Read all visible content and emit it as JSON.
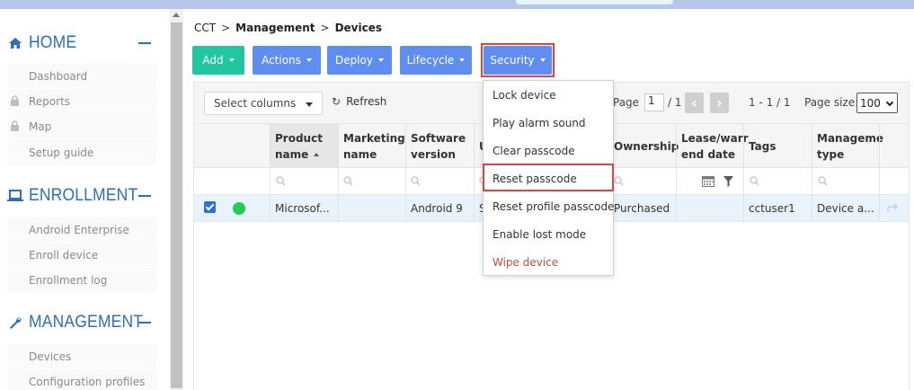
{
  "sidebar": {
    "sections": [
      {
        "label": "HOME",
        "icon": "home-icon",
        "items": [
          {
            "label": "Dashboard",
            "locked": false
          },
          {
            "label": "Reports",
            "locked": true
          },
          {
            "label": "Map",
            "locked": true
          },
          {
            "label": "Setup guide",
            "locked": false
          }
        ]
      },
      {
        "label": "ENROLLMENT",
        "icon": "laptop-icon",
        "items": [
          {
            "label": "Android Enterprise"
          },
          {
            "label": "Enroll device"
          },
          {
            "label": "Enrollment log"
          }
        ]
      },
      {
        "label": "MANAGEMENT",
        "icon": "wrench-icon",
        "items": [
          {
            "label": "Devices"
          },
          {
            "label": "Configuration profiles"
          }
        ]
      }
    ]
  },
  "breadcrumb": {
    "root": "CCT",
    "sep": ">",
    "level1": "Management",
    "level2": "Devices"
  },
  "toolbar": {
    "add": "Add",
    "actions": "Actions",
    "deploy": "Deploy",
    "lifecycle": "Lifecycle",
    "security": "Security"
  },
  "grid": {
    "select_columns": "Select columns",
    "refresh": "Refresh",
    "pager": {
      "page_label": "Page",
      "page_value": "1",
      "page_total": "/ 1",
      "range": "1 - 1 / 1",
      "size_label": "Page size:",
      "size_value": "100"
    },
    "columns": [
      {
        "line1": "Product",
        "line2": "name"
      },
      {
        "line1": "Marketing",
        "line2": "name"
      },
      {
        "line1": "Software",
        "line2": "version"
      },
      {
        "line1": "U",
        "line2": ""
      },
      {
        "line1": "Ownership",
        "line2": ""
      },
      {
        "line1": "Lease/warr",
        "line2": "end date"
      },
      {
        "line1": "Tags",
        "line2": ""
      },
      {
        "line1": "Manageme",
        "line2": "type"
      }
    ],
    "row": {
      "product_name": "Microsof...",
      "marketing_name": "",
      "software_version": "Android 9",
      "u": "S",
      "ownership": "Purchased",
      "lease_end": "",
      "tags": "cctuser1",
      "management_type": "Device a..."
    }
  },
  "security_menu": [
    {
      "label": "Lock device"
    },
    {
      "label": "Play alarm sound"
    },
    {
      "label": "Clear passcode"
    },
    {
      "label": "Reset passcode"
    },
    {
      "label": "Reset profile passcode"
    },
    {
      "label": "Enable lost mode"
    },
    {
      "label": "Wipe device"
    }
  ],
  "colors": {
    "accent": "#2c6fbf",
    "add": "#21c6a1",
    "button": "#5d8ef0",
    "highlight": "#d9463d",
    "status_online": "#22cc55",
    "status_unknown": "#9a9a9a"
  }
}
